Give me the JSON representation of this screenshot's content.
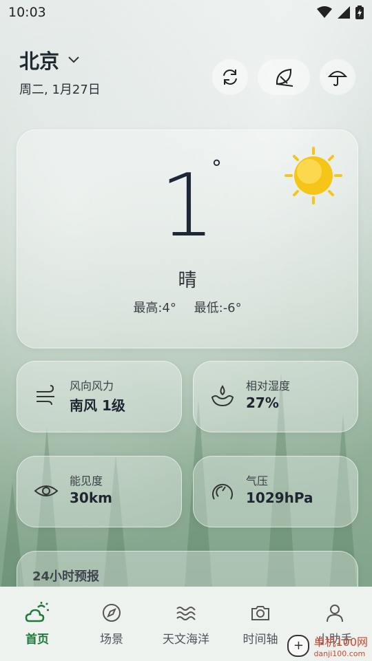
{
  "status": {
    "time": "10:03"
  },
  "header": {
    "city": "北京",
    "date": "周二, 1月27日"
  },
  "current": {
    "temp": "1",
    "degree": "°",
    "condition": "晴",
    "high": "最高:4°",
    "low": "最低:-6°"
  },
  "info_cards": [
    {
      "label": "风向风力",
      "value": "南风 1级",
      "icon": "wind-icon"
    },
    {
      "label": "相对湿度",
      "value": "27%",
      "icon": "humidity-icon"
    },
    {
      "label": "能见度",
      "value": "30km",
      "icon": "eye-icon"
    },
    {
      "label": "气压",
      "value": "1029hPa",
      "icon": "gauge-icon"
    }
  ],
  "forecast": {
    "title": "24小时预报"
  },
  "nav": {
    "items": [
      {
        "label": "首页",
        "icon": "weather-home-icon",
        "active": true
      },
      {
        "label": "场景",
        "icon": "compass-icon"
      },
      {
        "label": "天文海洋",
        "icon": "waves-icon"
      },
      {
        "label": "时间轴",
        "icon": "camera-icon"
      },
      {
        "label": "小助手",
        "icon": "person-icon"
      }
    ]
  },
  "watermark": {
    "text": "单机100网",
    "sub": "danji100.com"
  },
  "colors": {
    "accent": "#1e7a3b",
    "sun": "#f5c518"
  }
}
